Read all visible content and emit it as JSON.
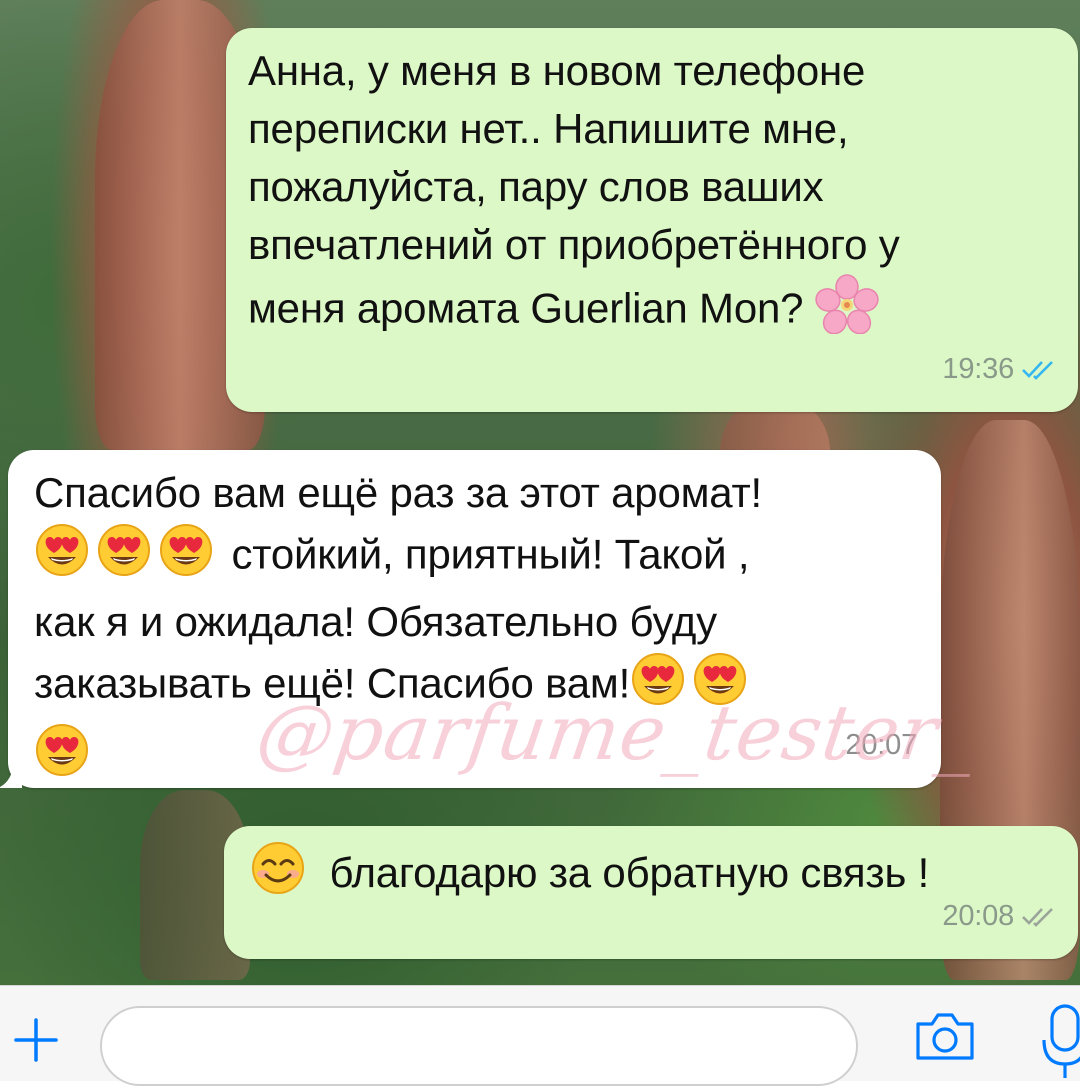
{
  "chat": {
    "messages": [
      {
        "direction": "outgoing",
        "lines": [
          "Анна, у меня в новом телефоне",
          "переписки нет.. Напишите мне,",
          "пожалуйста, пару слов ваших",
          "впечатлений от приобретённого у",
          "меня аромата Guerlian Mon?"
        ],
        "emoji": "cherry-blossom",
        "time": "19:36",
        "status": "read",
        "status_color": "#34b7f1"
      },
      {
        "direction": "incoming",
        "line1": "Спасибо вам ещё раз за этот аромат!",
        "line2_text": "стойкий, приятный! Такой ,",
        "line3": "как я и ожидала! Обязательно буду",
        "line4_text": "заказывать ещё! Спасибо вам!",
        "emoji": "heart-eyes",
        "time": "20:07"
      },
      {
        "direction": "outgoing",
        "text": "благодарю за обратную связь !",
        "emoji": "smiling-face",
        "time": "20:08",
        "status": "delivered",
        "status_color": "#9aa49a"
      }
    ],
    "watermark": "@parfume_tester_"
  },
  "composer": {
    "plus_icon": "plus-icon",
    "input_value": "",
    "camera_icon": "camera-icon",
    "mic_icon": "microphone-icon",
    "accent_color": "#007aff"
  },
  "colors": {
    "outgoing_bubble": "#dcf8c6",
    "incoming_bubble": "#ffffff",
    "watermark": "#f0aab9"
  }
}
